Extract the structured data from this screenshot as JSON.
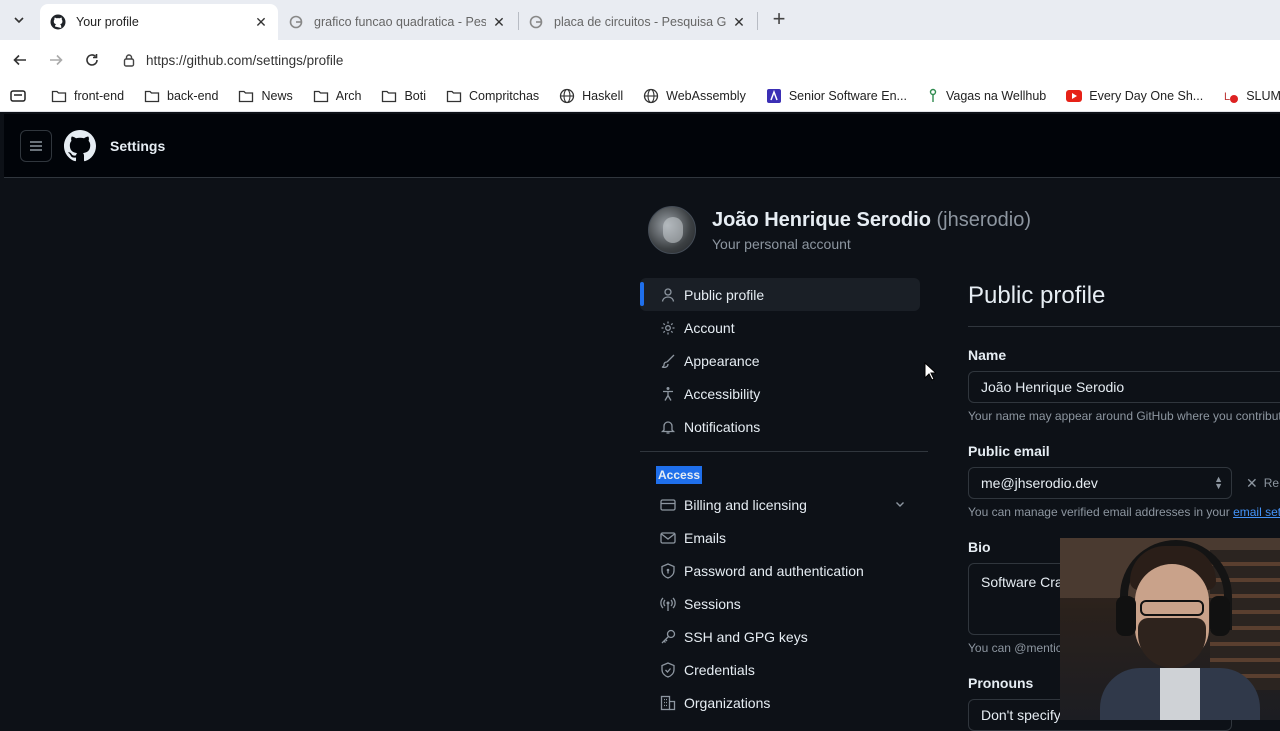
{
  "browser": {
    "tabs": [
      {
        "title": "Your profile",
        "active": true,
        "favicon": "github-icon"
      },
      {
        "title": "grafico funcao quadratica - Pesqui",
        "active": false,
        "favicon": "google-icon"
      },
      {
        "title": "placa de circuitos - Pesquisa Goog",
        "active": false,
        "favicon": "google-icon"
      }
    ],
    "url": "https://github.com/settings/profile",
    "bookmarks": [
      {
        "label": "front-end",
        "icon": "folder-icon"
      },
      {
        "label": "back-end",
        "icon": "folder-icon"
      },
      {
        "label": "News",
        "icon": "folder-icon"
      },
      {
        "label": "Arch",
        "icon": "folder-icon"
      },
      {
        "label": "Boti",
        "icon": "folder-icon"
      },
      {
        "label": "Compritchas",
        "icon": "folder-icon"
      },
      {
        "label": "Haskell",
        "icon": "globe-icon"
      },
      {
        "label": "WebAssembly",
        "icon": "globe-icon"
      },
      {
        "label": "Senior Software En...",
        "icon": "site-icon"
      },
      {
        "label": "Vagas na Wellhub",
        "icon": "site-icon"
      },
      {
        "label": "Every Day One Sh...",
        "icon": "youtube-icon"
      },
      {
        "label": "SLUM: The Sh",
        "icon": "site-icon"
      }
    ]
  },
  "header": {
    "title": "Settings"
  },
  "profile": {
    "name": "João Henrique Serodio",
    "login": "(jhserodio)",
    "subtitle": "Your personal account"
  },
  "nav": {
    "items": [
      {
        "label": "Public profile",
        "icon": "person-icon",
        "selected": true
      },
      {
        "label": "Account",
        "icon": "gear-icon"
      },
      {
        "label": "Appearance",
        "icon": "paintbrush-icon"
      },
      {
        "label": "Accessibility",
        "icon": "accessibility-icon"
      },
      {
        "label": "Notifications",
        "icon": "bell-icon"
      }
    ],
    "access_label": "Access",
    "access_items": [
      {
        "label": "Billing and licensing",
        "icon": "credit-card-icon",
        "expandable": true
      },
      {
        "label": "Emails",
        "icon": "mail-icon"
      },
      {
        "label": "Password and authentication",
        "icon": "shield-lock-icon"
      },
      {
        "label": "Sessions",
        "icon": "broadcast-icon"
      },
      {
        "label": "SSH and GPG keys",
        "icon": "key-icon"
      },
      {
        "label": "Credentials",
        "icon": "shield-check-icon"
      },
      {
        "label": "Organizations",
        "icon": "organization-icon"
      }
    ]
  },
  "main": {
    "title": "Public profile",
    "name_label": "Name",
    "name_value": "João Henrique Serodio",
    "name_note": "Your name may appear around GitHub where you contribut",
    "email_label": "Public email",
    "email_value": "me@jhserodio.dev",
    "remove_label": "Re",
    "email_note": "You can manage verified email addresses in your",
    "email_link": "email sett",
    "bio_label": "Bio",
    "bio_value": "Software Cra",
    "bio_note": "You can @mentic",
    "pronouns_label": "Pronouns",
    "pronouns_value": "Don't specify"
  },
  "colors": {
    "accent": "#1f6feb",
    "bg": "#0d1117",
    "header_bg": "#010409",
    "border": "#30363d",
    "muted": "#8d96a0"
  }
}
